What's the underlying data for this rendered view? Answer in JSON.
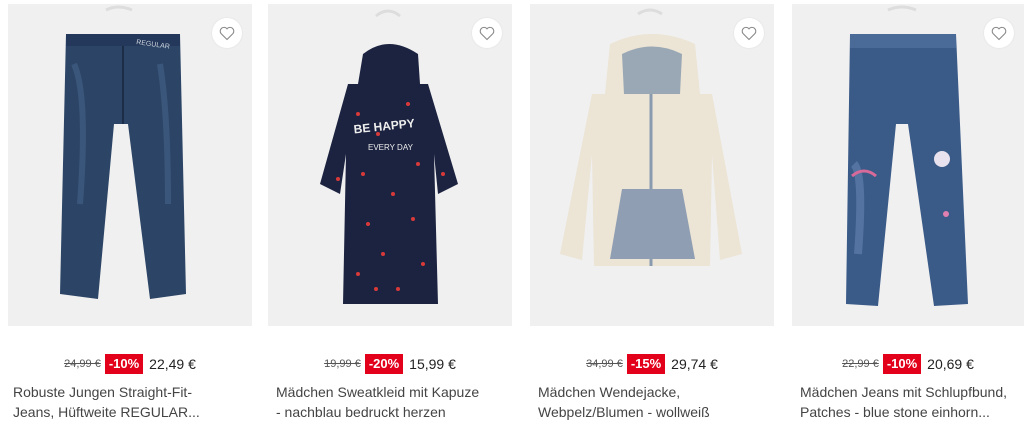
{
  "products": [
    {
      "old_price": "24,99 €",
      "discount": "-10%",
      "new_price": "22,49 €",
      "title_line1": "Robuste Jungen Straight-Fit-",
      "title_line2": "Jeans, Hüftweite REGULAR...",
      "label_print": "REGULAR",
      "image": "jeans-dark"
    },
    {
      "old_price": "19,99 €",
      "discount": "-20%",
      "new_price": "15,99 €",
      "title_line1": "Mädchen Sweatkleid mit Kapuze",
      "title_line2": "- nachblau bedruckt herzen",
      "print_line1": "BE HAPPY",
      "print_line2": "EVERY DAY",
      "image": "hoodie-dress"
    },
    {
      "old_price": "34,99 €",
      "discount": "-15%",
      "new_price": "29,74 €",
      "title_line1": "Mädchen Wendejacke,",
      "title_line2": "Webpelz/Blumen - wollweiß",
      "image": "sherpa-jacket"
    },
    {
      "old_price": "22,99 €",
      "discount": "-10%",
      "new_price": "20,69 €",
      "title_line1": "Mädchen Jeans mit Schlupfbund,",
      "title_line2": "Patches - blue stone einhorn...",
      "image": "jeans-unicorn"
    }
  ],
  "colors": {
    "badge": "#e3001b",
    "navy": "#1c2340",
    "denim": "#2f4a6e"
  },
  "icons": {
    "favorite": "heart-outline-icon"
  }
}
